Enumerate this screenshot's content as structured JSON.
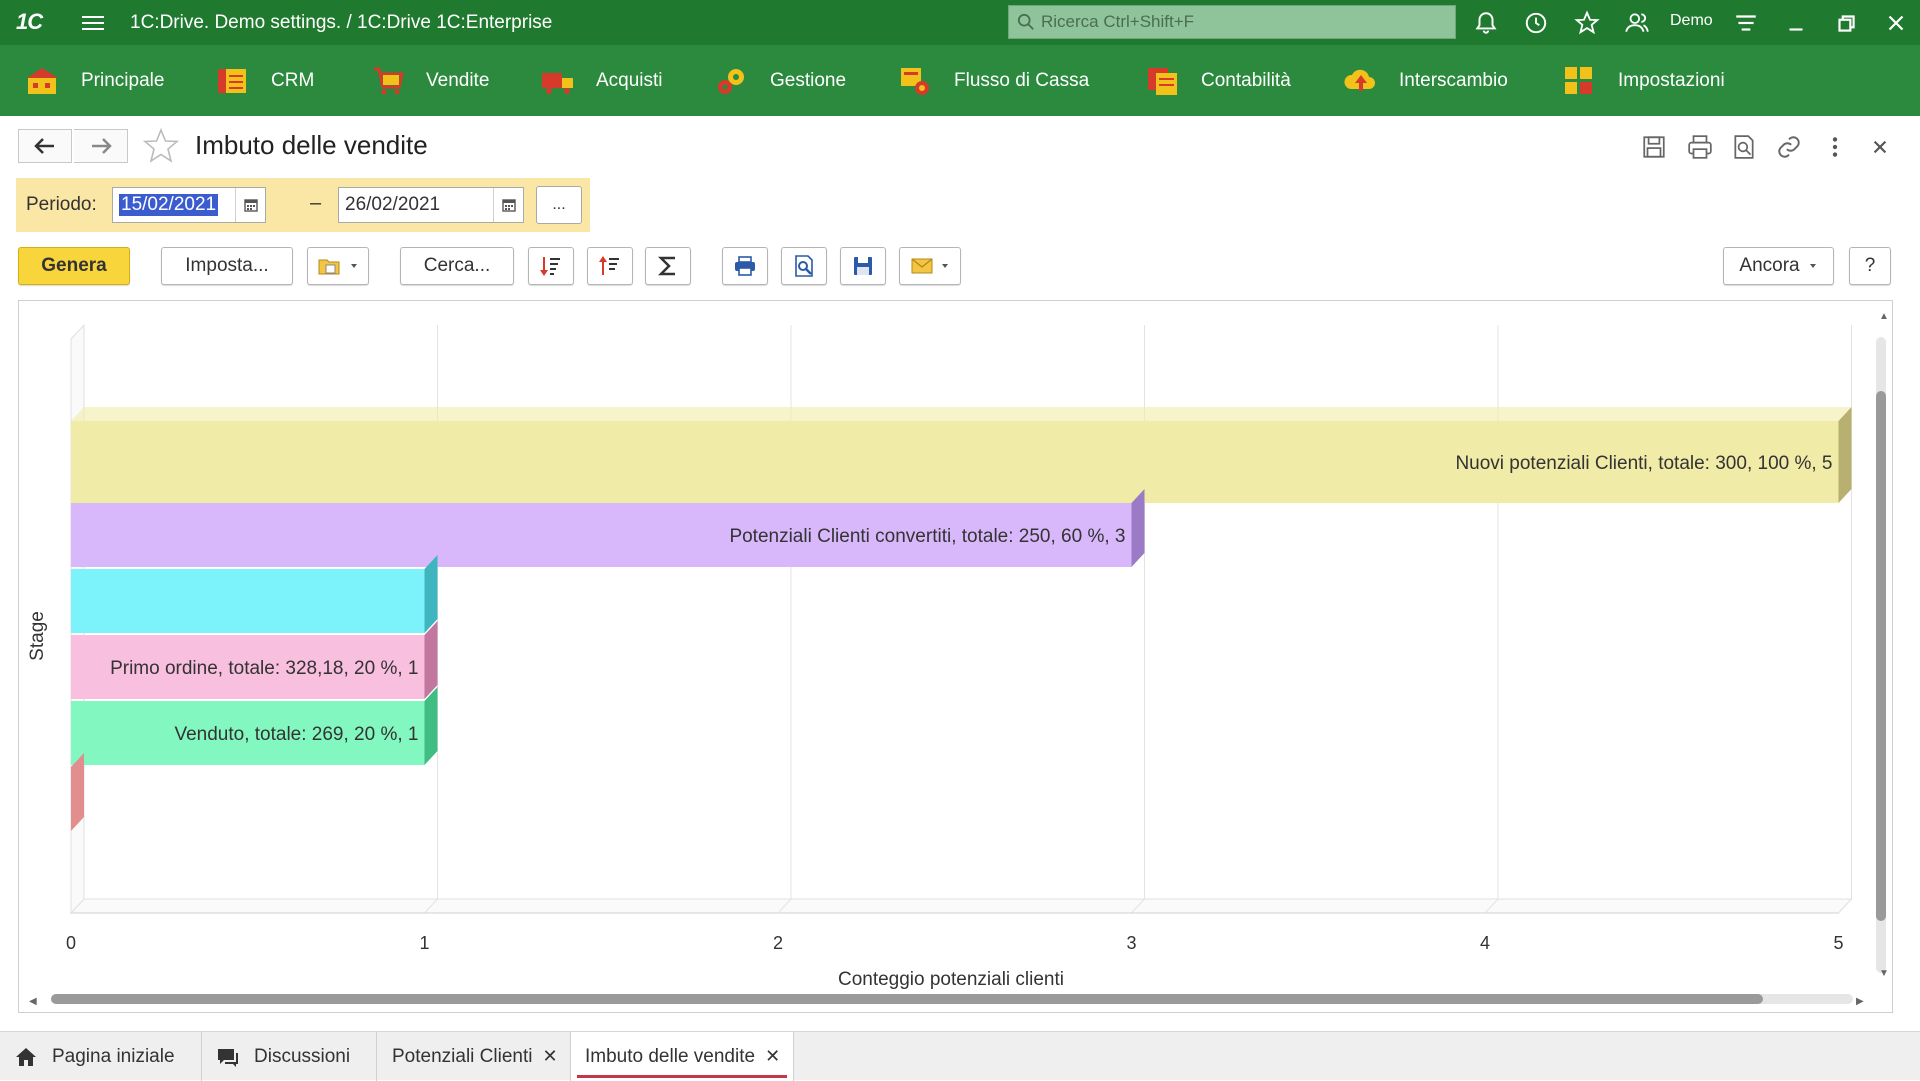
{
  "titlebar": {
    "logo": "1С",
    "title": "1C:Drive. Demo settings. / 1C:Drive 1C:Enterprise",
    "search_placeholder": "Ricerca Ctrl+Shift+F",
    "user": "Demo",
    "icons": [
      "bell-icon",
      "history-icon",
      "star-icon",
      "users-icon",
      "menu-lines-icon",
      "minimize-icon",
      "restore-icon",
      "close-icon"
    ]
  },
  "main_menu": [
    {
      "label": "Principale",
      "icon": "home-icon"
    },
    {
      "label": "CRM",
      "icon": "crm-icon"
    },
    {
      "label": "Vendite",
      "icon": "cart-icon"
    },
    {
      "label": "Acquisti",
      "icon": "truck-icon"
    },
    {
      "label": "Gestione",
      "icon": "gears-icon"
    },
    {
      "label": "Flusso di Cassa",
      "icon": "cash-icon"
    },
    {
      "label": "Contabilità",
      "icon": "ledger-icon"
    },
    {
      "label": "Interscambio",
      "icon": "cloud-upload-icon"
    },
    {
      "label": "Impostazioni",
      "icon": "settings-grid-icon"
    }
  ],
  "form": {
    "title": "Imbuto delle vendite",
    "period_label": "Periodo:",
    "date_from": "15/02/2021",
    "date_to": "26/02/2021",
    "period_dash": "–",
    "period_more": "..."
  },
  "toolbar": {
    "genera": "Genera",
    "imposta": "Imposta...",
    "cerca": "Cerca...",
    "ancora": "Ancora",
    "help": "?"
  },
  "chart_data": {
    "type": "bar",
    "orientation": "horizontal",
    "xlabel": "Conteggio potenziali clienti",
    "ylabel": "Stage",
    "xlim": [
      0,
      5
    ],
    "xticks": [
      "0",
      "1",
      "2",
      "3",
      "4",
      "5"
    ],
    "grid": true,
    "bars": [
      {
        "value": 5,
        "label": "Nuovi potenziali Clienti, totale: 300, 100 %, 5",
        "color": "#f1eba8",
        "side": "#b8b070"
      },
      {
        "value": 3,
        "label": "Potenziali Clienti convertiti, totale: 250, 60 %, 3",
        "color": "#d8b8fb",
        "side": "#9b7ac6"
      },
      {
        "value": 1,
        "label": "",
        "color": "#7cf3fb",
        "side": "#3fb6bf"
      },
      {
        "value": 1,
        "label": "Primo ordine, totale: 328,18, 20 %, 1",
        "color": "#f8bfdf",
        "side": "#c1779e"
      },
      {
        "value": 1,
        "label": "Venduto, totale: 269, 20 %, 1",
        "color": "#82f8c0",
        "side": "#3fbd82"
      },
      {
        "value": 0,
        "label": "",
        "color": "#e28e8e",
        "side": "#c86e6e"
      }
    ]
  },
  "tabs": [
    {
      "label": "Pagina iniziale",
      "icon": "home-icon",
      "closable": false
    },
    {
      "label": "Discussioni",
      "icon": "chat-icon",
      "closable": false
    },
    {
      "label": "Potenziali Clienti",
      "closable": true
    },
    {
      "label": "Imbuto delle vendite",
      "closable": true,
      "active": true
    }
  ],
  "colors": {
    "titlebar": "#1f7a30",
    "menubar": "#2b8a3e",
    "period_bg": "#fbe7a5",
    "genera_btn": "#f7d53b",
    "active_tab_underline": "#c0384a"
  }
}
